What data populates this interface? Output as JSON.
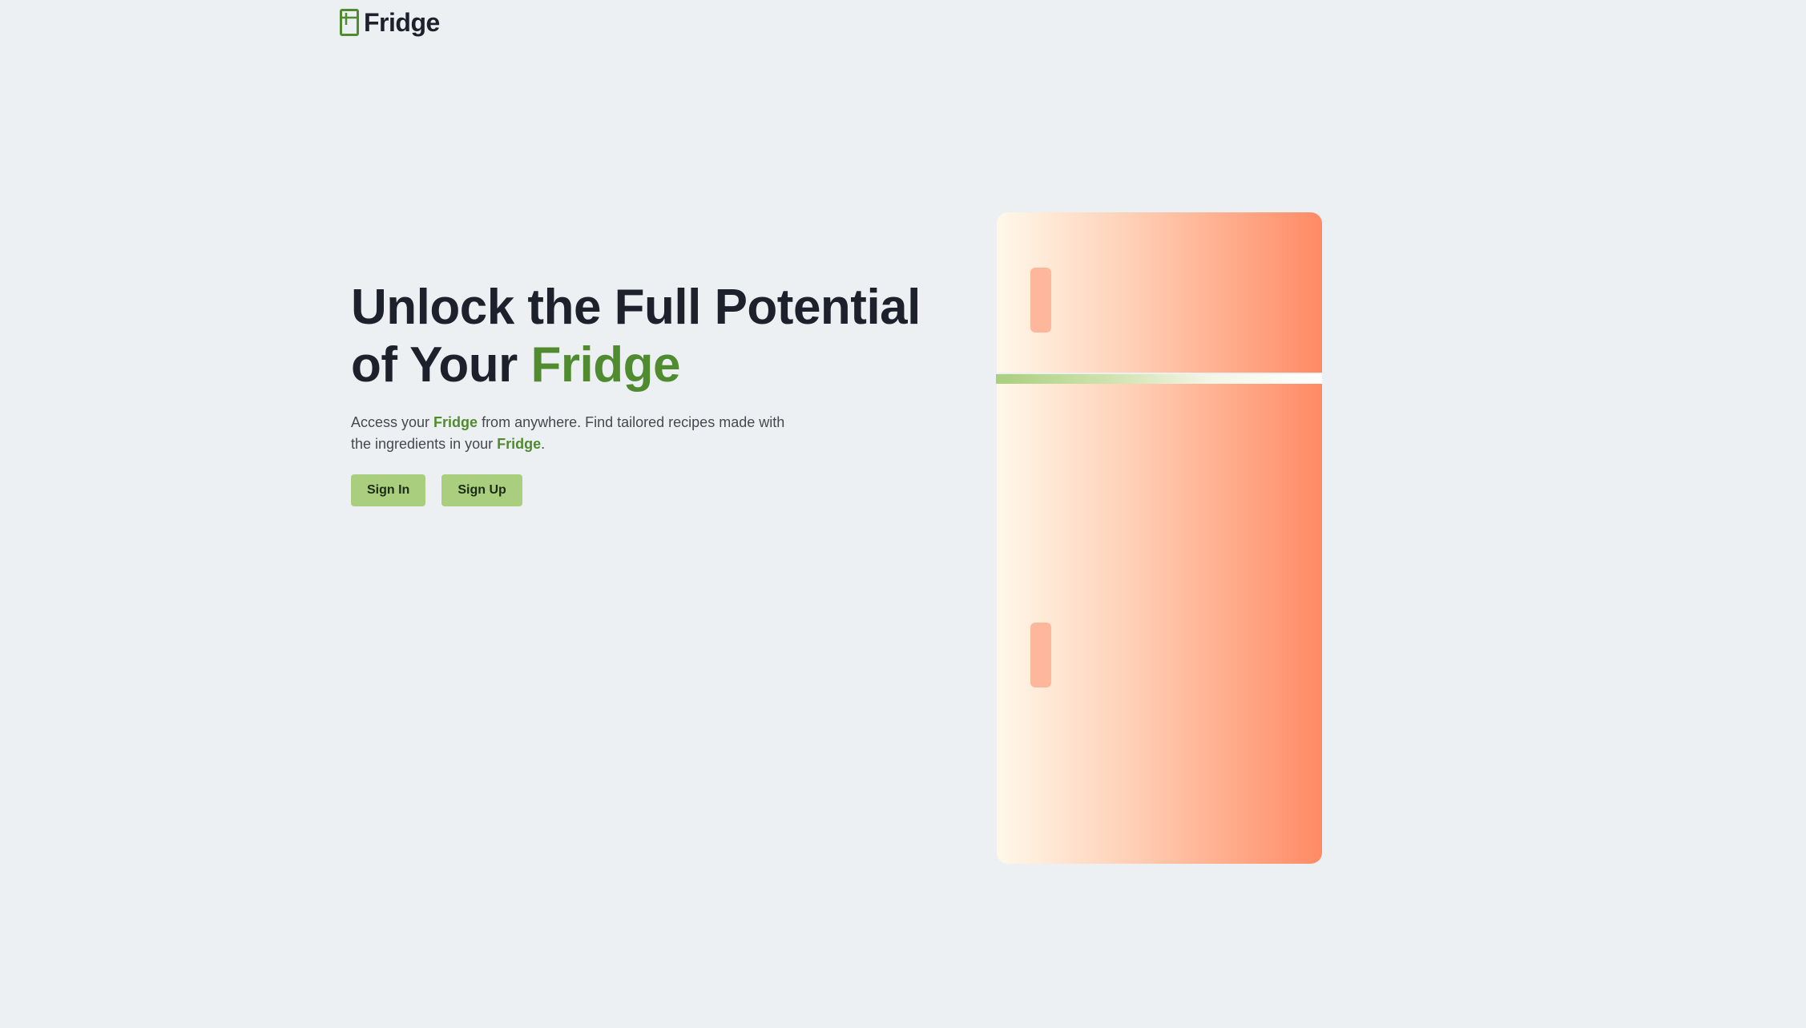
{
  "nav": {
    "brand": "Fridge",
    "logo_icon": "fridge-icon",
    "logo_color": "#508b2f"
  },
  "hero": {
    "title_line1": "Unlock the Full Potential",
    "title_line2_prefix": "of Your ",
    "title_line2_accent": "Fridge",
    "desc_part1": "Access your ",
    "desc_accent1": "Fridge",
    "desc_part2": " from anywhere. Find tailored recipes made with the ingredients in your ",
    "desc_accent2": "Fridge",
    "desc_part3": "."
  },
  "actions": {
    "sign_in_label": "Sign In",
    "sign_up_label": "Sign Up"
  },
  "colors": {
    "background": "#edf0f3",
    "accent_green": "#508b2f",
    "button_green": "#a9cf7e",
    "fridge_gradient_start": "#fff8ea",
    "fridge_gradient_end": "#ff8a64",
    "handle": "#ffb79c"
  },
  "illustration": {
    "name": "fridge-illustration"
  }
}
